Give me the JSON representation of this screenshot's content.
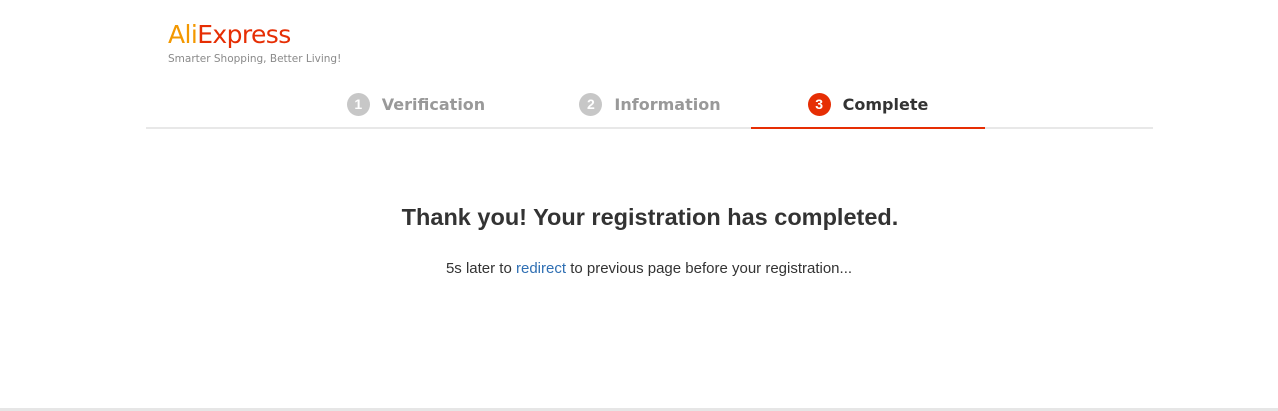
{
  "brand": {
    "name_part1": "Ali",
    "name_part2": "Express",
    "slogan": "Smarter Shopping, Better Living!",
    "colors": {
      "ali": "#f39800",
      "express": "#e62e04"
    }
  },
  "steps": [
    {
      "number": "1",
      "label": "Verification",
      "state": "done"
    },
    {
      "number": "2",
      "label": "Information",
      "state": "done"
    },
    {
      "number": "3",
      "label": "Complete",
      "state": "active"
    }
  ],
  "colors": {
    "accent": "#e62e04",
    "inactive_step": "#c7c7c7",
    "link": "#2f6fb3"
  },
  "result": {
    "headline": "Thank you! Your registration has completed.",
    "message_prefix": "5s later to ",
    "redirect_link": "redirect",
    "message_suffix": " to previous page before your registration..."
  }
}
